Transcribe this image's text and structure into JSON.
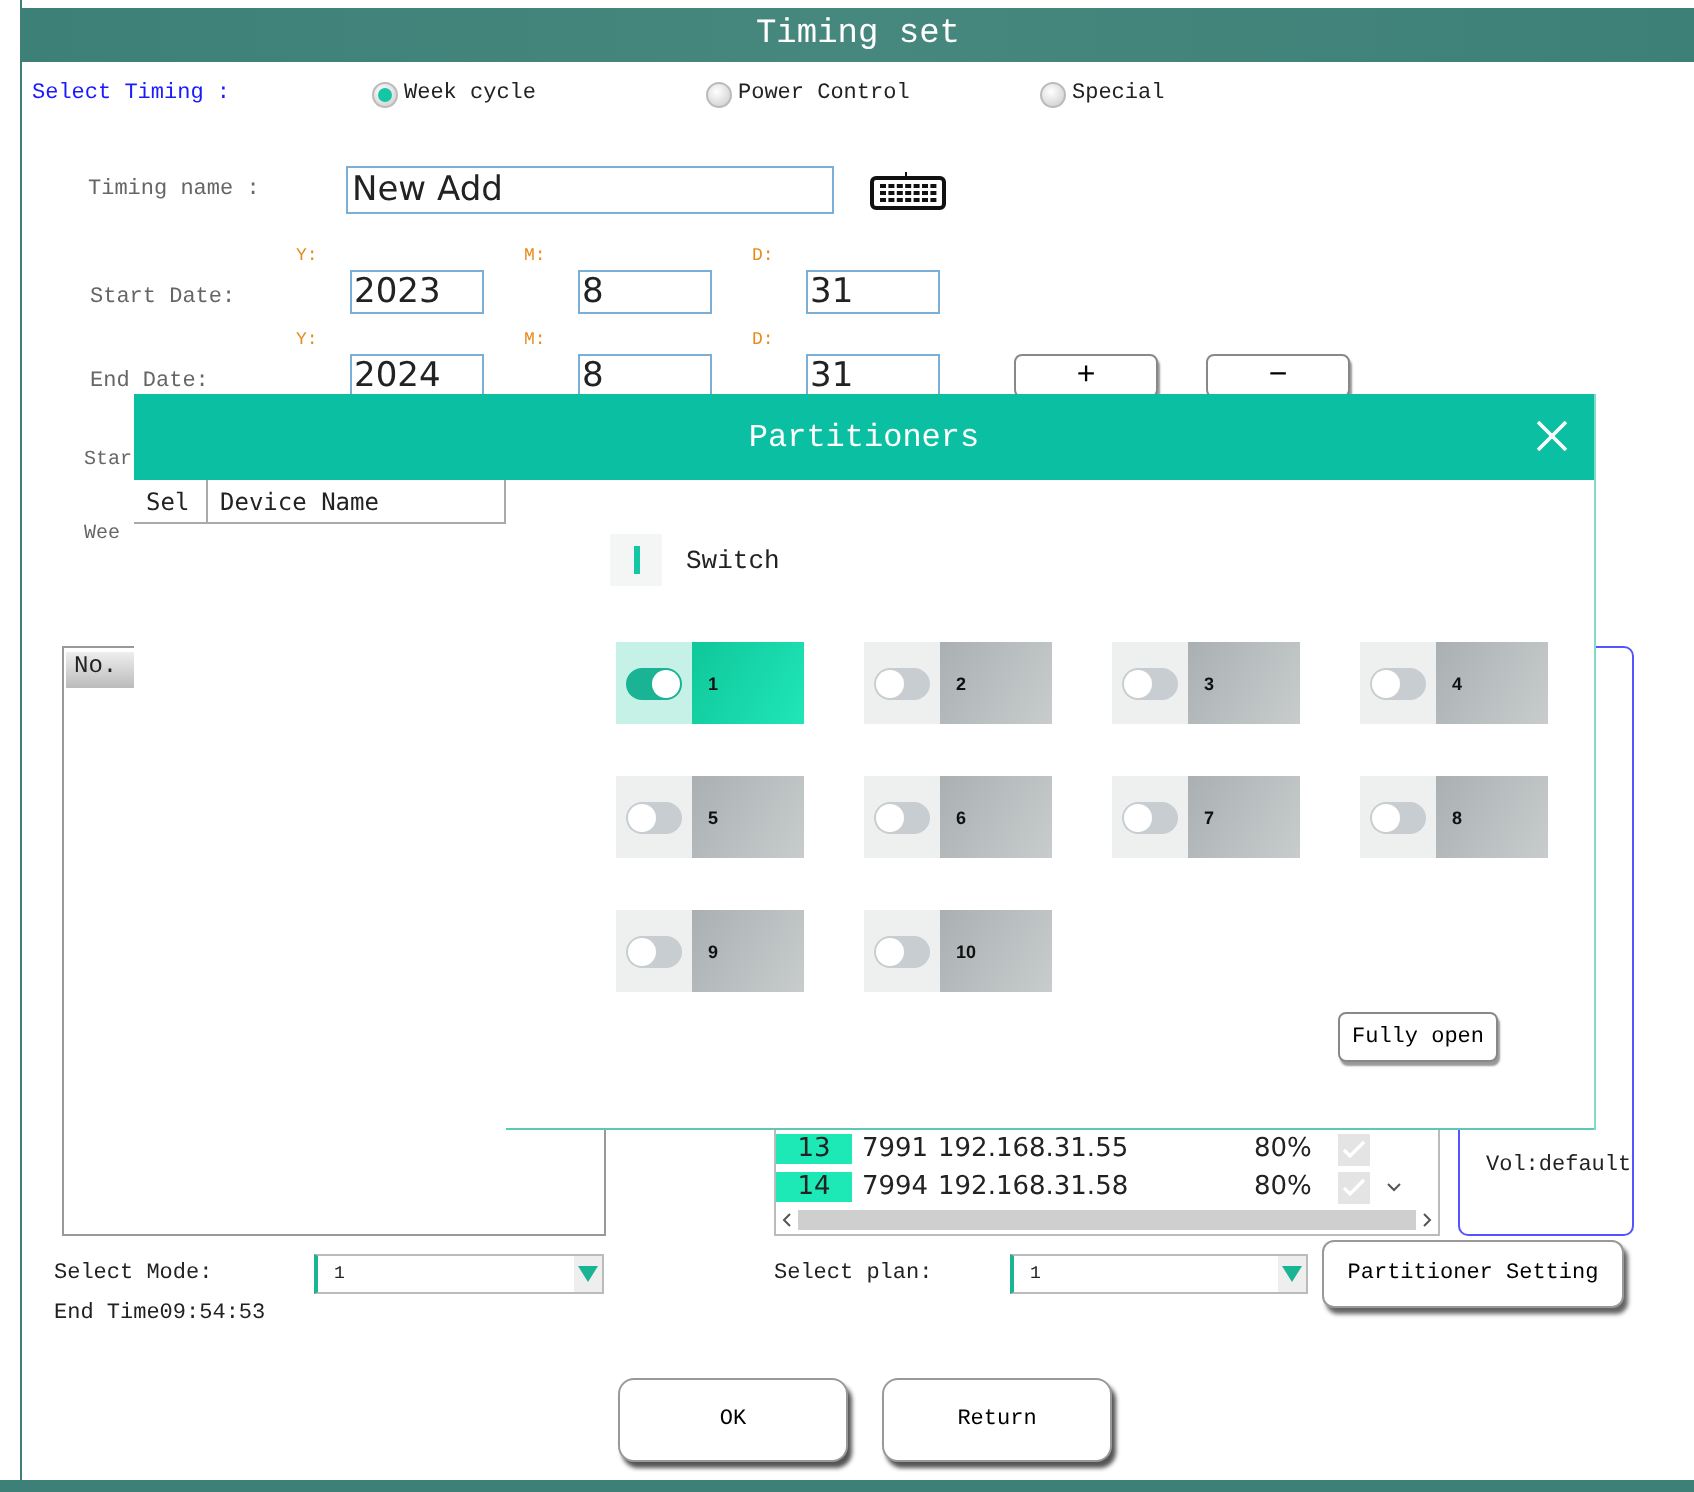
{
  "window": {
    "title": "Timing set"
  },
  "select_timing": {
    "label": "Select Timing :",
    "options": [
      {
        "label": "Week cycle",
        "selected": true
      },
      {
        "label": "Power Control",
        "selected": false
      },
      {
        "label": "Special",
        "selected": false
      }
    ]
  },
  "timing_name": {
    "label": "Timing name :",
    "value": "New Add"
  },
  "start_date": {
    "label": "Start Date:",
    "fields": [
      {
        "label": "Y:",
        "value": "2023"
      },
      {
        "label": "M:",
        "value": "8"
      },
      {
        "label": "D:",
        "value": "31"
      }
    ]
  },
  "end_date": {
    "label": "End Date:",
    "fields": [
      {
        "label": "Y:",
        "value": "2024"
      },
      {
        "label": "M:",
        "value": "8"
      },
      {
        "label": "D:",
        "value": "31"
      }
    ],
    "buttons": [
      "+",
      "−"
    ]
  },
  "partial_labels": [
    "Star",
    "Wee"
  ],
  "list_table": {
    "header": "No."
  },
  "device_table": {
    "columns": [
      "Sel",
      "Device Name"
    ],
    "rows": [
      {
        "cells": [
          "13",
          "7991",
          "192.168.31.55",
          "80%"
        ],
        "checked": true
      },
      {
        "cells": [
          "14",
          "7994",
          "192.168.31.58",
          "80%"
        ],
        "checked": true
      }
    ]
  },
  "vol_label": "Vol:default",
  "select_mode": {
    "label": "Select Mode:",
    "value": "1"
  },
  "end_time": "End Time09:54:53",
  "select_plan": {
    "label": "Select  plan:",
    "value": "1"
  },
  "partitioner_setting_button": "Partitioner Setting",
  "buttons": [
    "OK",
    "Return"
  ],
  "dialog": {
    "title": "Partitioners",
    "switch_label": "Switch",
    "fully_open_button": "Fully open",
    "zones": [
      {
        "label": "1",
        "on": true
      },
      {
        "label": "2",
        "on": false
      },
      {
        "label": "3",
        "on": false
      },
      {
        "label": "4",
        "on": false
      },
      {
        "label": "5",
        "on": false
      },
      {
        "label": "6",
        "on": false
      },
      {
        "label": "7",
        "on": false
      },
      {
        "label": "8",
        "on": false
      },
      {
        "label": "9",
        "on": false
      },
      {
        "label": "10",
        "on": false
      }
    ]
  }
}
